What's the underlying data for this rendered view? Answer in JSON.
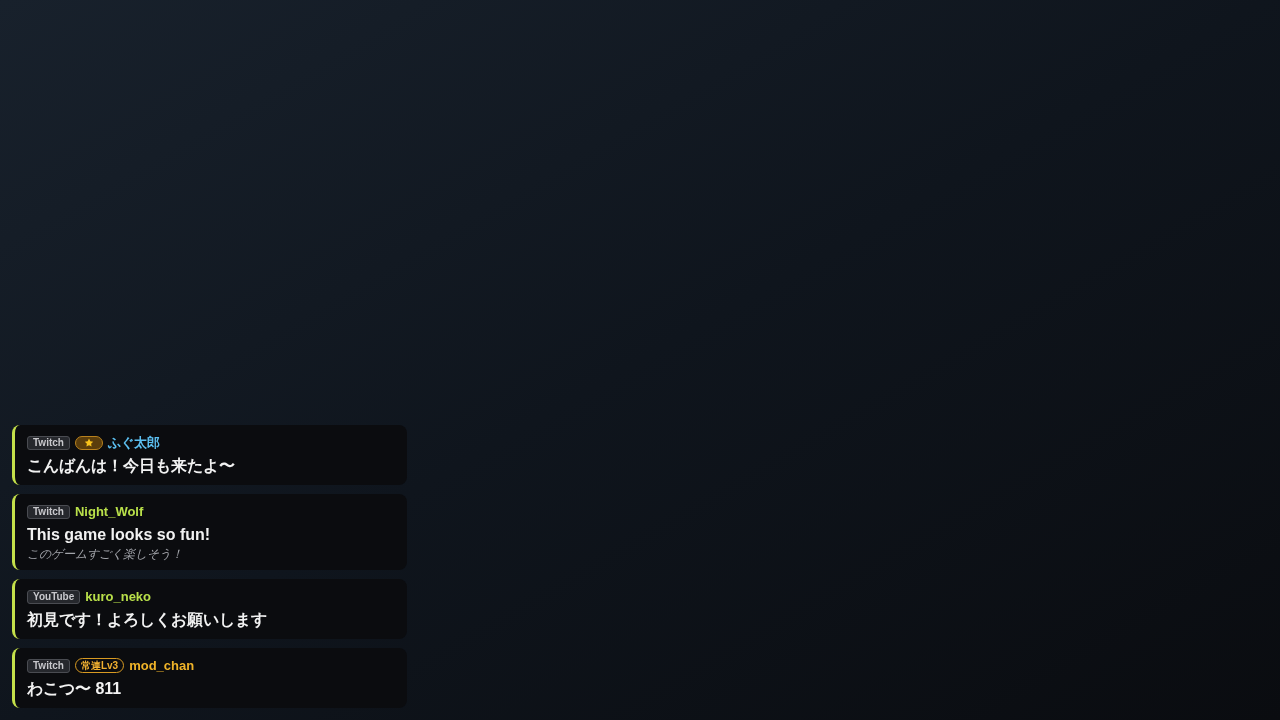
{
  "messages": [
    {
      "platform": "Twitch",
      "badges": [
        {
          "kind": "star"
        }
      ],
      "username": "ふぐ太郎",
      "color": "#5cbff0",
      "text": "こんばんは！今日も来たよ〜"
    },
    {
      "platform": "Twitch",
      "username": "Night_Wolf",
      "color": "#b9e04a",
      "text": "This game looks so fun!",
      "translation": "このゲームすごく楽しそう！"
    },
    {
      "platform": "YouTube",
      "username": "kuro_neko",
      "color": "#b9e04a",
      "text": "初見です！よろしくお願いします"
    },
    {
      "platform": "Twitch",
      "badges": [
        {
          "kind": "text",
          "label": "常連Lv3"
        }
      ],
      "username": "mod_chan",
      "color": "#f0b429",
      "text": "わこつ〜 811"
    }
  ]
}
